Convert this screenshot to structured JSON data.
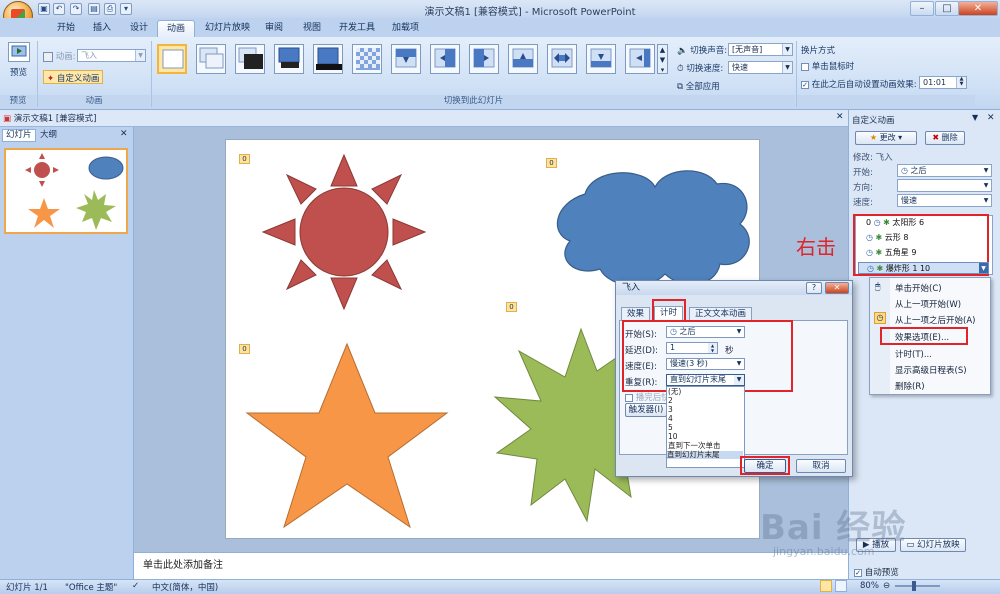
{
  "window": {
    "title": "演示文稿1 [兼容模式] - Microsoft PowerPoint",
    "minimize": "–",
    "restore": "□",
    "close": "✕"
  },
  "tabs": [
    "开始",
    "插入",
    "设计",
    "动画",
    "幻灯片放映",
    "审阅",
    "视图",
    "开发工具",
    "加载项"
  ],
  "active_tab": "动画",
  "ribbon": {
    "preview_label": "预览",
    "preview_group": "预览",
    "animation_label": "动画:",
    "animation_value": "飞入",
    "custom_anim_button": "自定义动画",
    "animation_group": "动画",
    "transition_group": "切换到此幻灯片",
    "sound_label": "切换声音:",
    "sound_value": "[无声音]",
    "speed_label": "切换速度:",
    "speed_value": "快速",
    "apply_all": "全部应用",
    "advance_title": "换片方式",
    "on_click": "单击鼠标时",
    "after_label": "在此之后自动设置动画效果:",
    "after_value": "01:01"
  },
  "doc_tab": "演示文稿1 [兼容模式]",
  "left_pane": {
    "tab_slides": "幻灯片",
    "tab_outline": "大纲",
    "slide_number": "1"
  },
  "slide": {
    "tag_sun": "0",
    "tag_cloud": "0",
    "tag_star": "0",
    "tag_burst": "0"
  },
  "notes_placeholder": "单击此处添加备注",
  "task_pane": {
    "title": "自定义动画",
    "change_button": "更改",
    "delete_button": "删除",
    "modify_label": "修改: 飞入",
    "start_label": "开始:",
    "start_value": "之后",
    "direction_label": "方向:",
    "direction_value": "",
    "speed_label": "速度:",
    "speed_value": "慢速",
    "list_items": [
      {
        "num": "0",
        "label": "太阳形 6"
      },
      {
        "num": "",
        "label": "云形 8"
      },
      {
        "num": "",
        "label": "五角星 9"
      },
      {
        "num": "",
        "label": "爆炸形 1 10"
      }
    ],
    "play_button": "播放",
    "slideshow_button": "幻灯片放映",
    "auto_preview": "自动预览"
  },
  "context_menu": [
    "单击开始(C)",
    "从上一项开始(W)",
    "从上一项之后开始(A)",
    "效果选项(E)...",
    "计时(T)...",
    "显示高级日程表(S)",
    "删除(R)"
  ],
  "annotation": "右击",
  "dialog": {
    "title": "飞入",
    "help": "?",
    "close": "✕",
    "tabs": [
      "效果",
      "计时",
      "正文文本动画"
    ],
    "active_tab": "计时",
    "start_label": "开始(S):",
    "start_value": "之后",
    "delay_label": "延迟(D):",
    "delay_value": "1",
    "delay_unit": "秒",
    "speed_label": "速度(E):",
    "speed_value": "慢速(3 秒)",
    "repeat_label": "重复(R):",
    "repeat_value": "直到幻灯片末尾",
    "rewind_label": "播完后快退",
    "trigger_button": "触发器(I)",
    "repeat_options": [
      "(无)",
      "2",
      "3",
      "4",
      "5",
      "10",
      "直到下一次单击",
      "直到幻灯片末尾"
    ],
    "ok": "确定",
    "cancel": "取消"
  },
  "status_bar": {
    "slide_info": "幻灯片 1/1",
    "theme": "\"Office 主题\"",
    "language": "中文(简体，中国)",
    "zoom": "80%"
  },
  "watermark": "Bai 经验",
  "watermark_url": "jingyan.baidu.com",
  "colors": {
    "sun": "#c0504d",
    "cloud": "#4f81bd",
    "star": "#f79646",
    "burst": "#9bbb59",
    "highlight": "#e0242a"
  }
}
